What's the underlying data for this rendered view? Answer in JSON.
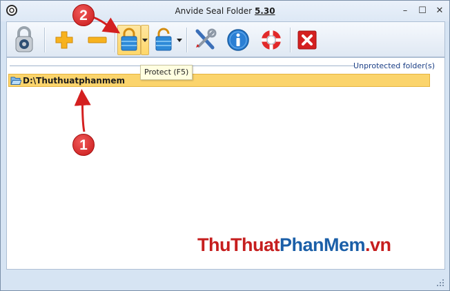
{
  "window": {
    "title": "Anvide Seal Folder",
    "version": "5.30",
    "minimize_glyph": "–",
    "maximize_glyph": "☐",
    "close_glyph": "✕"
  },
  "toolbar": {
    "buttons": [
      {
        "id": "app-lock",
        "icon": "padlock-icon"
      },
      {
        "id": "add-folder",
        "icon": "plus-icon"
      },
      {
        "id": "remove-folder",
        "icon": "minus-icon"
      },
      {
        "id": "protect",
        "icon": "lock-closed-icon",
        "pressed": true
      },
      {
        "id": "unprotect",
        "icon": "lock-open-icon"
      },
      {
        "id": "settings",
        "icon": "wrench-screwdriver-icon"
      },
      {
        "id": "info",
        "icon": "info-icon"
      },
      {
        "id": "help",
        "icon": "lifebuoy-icon"
      },
      {
        "id": "exit",
        "icon": "close-red-icon"
      }
    ],
    "tooltip": "Protect (F5)"
  },
  "panel": {
    "section_label": "Unprotected folder(s)",
    "folders": [
      {
        "path": "D:\\Thuthuatphanmem"
      }
    ]
  },
  "watermark": {
    "part1": "ThuThuat",
    "part2": "PhanMem",
    "part3": ".vn"
  },
  "annotations": {
    "badge_1": "1",
    "badge_2": "2",
    "color": "#d42020"
  },
  "colors": {
    "selection": "#fbd46c",
    "header_text": "#1a3e85",
    "window_bg": "#d6e4f3"
  }
}
